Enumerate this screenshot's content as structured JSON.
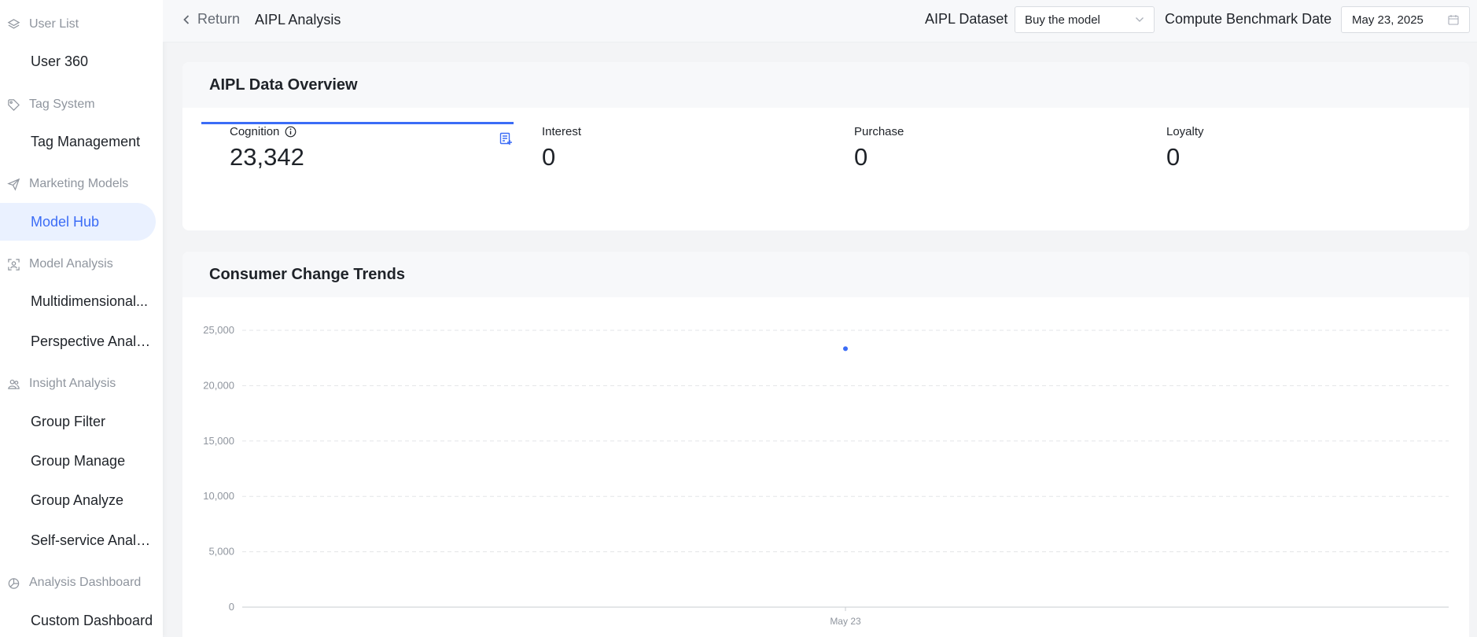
{
  "sidebar": {
    "groups": [
      {
        "title": "User List",
        "icon": "layers-icon",
        "items": [
          {
            "label": "User 360"
          }
        ]
      },
      {
        "title": "Tag System",
        "icon": "tag-icon",
        "items": [
          {
            "label": "Tag Management"
          }
        ]
      },
      {
        "title": "Marketing Models",
        "icon": "send-icon",
        "items": [
          {
            "label": "Model Hub",
            "active": true
          }
        ]
      },
      {
        "title": "Model Analysis",
        "icon": "scan-person-icon",
        "items": [
          {
            "label": "Multidimensional..."
          },
          {
            "label": "Perspective Analy..."
          }
        ]
      },
      {
        "title": "Insight Analysis",
        "icon": "users-icon",
        "items": [
          {
            "label": "Group Filter"
          },
          {
            "label": "Group Manage"
          },
          {
            "label": "Group Analyze"
          },
          {
            "label": "Self-service Analy..."
          }
        ]
      },
      {
        "title": "Analysis Dashboard",
        "icon": "pie-chart-icon",
        "items": [
          {
            "label": "Custom Dashboard"
          }
        ]
      }
    ]
  },
  "header": {
    "back_label": "Return",
    "title": "AIPL Analysis",
    "dataset_label": "AIPL Dataset",
    "dataset_value": "Buy the model",
    "benchmark_label": "Compute Benchmark Date",
    "benchmark_value": "May 23, 2025"
  },
  "overview": {
    "title": "AIPL Data Overview",
    "metrics": [
      {
        "label": "Cognition",
        "value": "23,342"
      },
      {
        "label": "Interest",
        "value": "0"
      },
      {
        "label": "Purchase",
        "value": "0"
      },
      {
        "label": "Loyalty",
        "value": "0"
      }
    ]
  },
  "trends": {
    "title": "Consumer Change Trends"
  },
  "chart_data": {
    "type": "line",
    "categories": [
      "May 23"
    ],
    "series": [
      {
        "values": [
          23342
        ]
      }
    ],
    "ylim": [
      0,
      25000
    ],
    "yticks": [
      0,
      5000,
      10000,
      15000,
      20000,
      25000
    ],
    "ytick_labels": [
      "0",
      "5,000",
      "10,000",
      "15,000",
      "20,000",
      "25,000"
    ],
    "grid": true,
    "color": "#3b6cf6"
  },
  "colors": {
    "accent": "#3b6cf6",
    "active_bg": "#eaf1ff"
  }
}
